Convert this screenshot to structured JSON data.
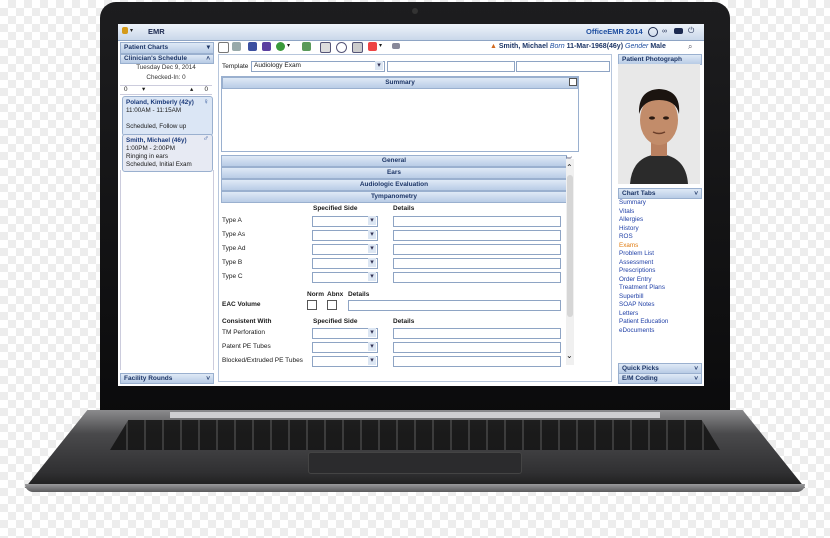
{
  "app": {
    "title": "EMR",
    "product": "OfficeEMR 2014"
  },
  "patient": {
    "name": "Smith, Michael",
    "born_label": "Born",
    "born": "11-Mar-1968(46y)",
    "gender_label": "Gender",
    "gender": "Male"
  },
  "left": {
    "patient_charts": "Patient Charts",
    "schedule_title": "Clinician's Schedule",
    "date": "Tuesday Dec 9, 2014",
    "checked_in": "Checked-In: 0",
    "counter_left": "0",
    "counter_right": "0",
    "appointments": [
      {
        "name": "Poland, Kimberly (42y)",
        "time": "11:00AM - 11:15AM",
        "reason": "",
        "status": "Scheduled, Follow up"
      },
      {
        "name": "Smith, Michael (46y)",
        "time": "1:00PM - 2:00PM",
        "reason": "Ringing in ears",
        "status": "Scheduled, Initial Exam"
      }
    ],
    "facility_rounds": "Facility Rounds"
  },
  "center": {
    "template_label": "Template",
    "template_value": "Audiology Exam",
    "summary": "Summary",
    "sections": [
      "General",
      "Ears",
      "Audiologic Evaluation",
      "Tympanometry"
    ],
    "specified_side": "Specified Side",
    "details": "Details",
    "types": [
      "Type A",
      "Type As",
      "Type Ad",
      "Type B",
      "Type C"
    ],
    "norm": "Norm",
    "abnx": "Abnx",
    "eac_volume": "EAC Volume",
    "consistent_with": "Consistent With",
    "consistent_rows": [
      "TM Perforation",
      "Patent PE Tubes",
      "Blocked/Extruded PE Tubes"
    ]
  },
  "right": {
    "photo_title": "Patient Photograph",
    "chart_tabs": "Chart Tabs",
    "tabs": [
      "Summary",
      "Vitals",
      "Allergies",
      "History",
      "ROS",
      "Exams",
      "Problem List",
      "Assessment",
      "Prescriptions",
      "Order Entry",
      "Treatment Plans",
      "Superbill",
      "SOAP Notes",
      "Letters",
      "Patient Education",
      "eDocuments"
    ],
    "active_tab": "Exams",
    "quick_picks": "Quick Picks",
    "em_coding": "E/M Coding"
  },
  "colors": {
    "accent": "#1f4fa0",
    "active_tab": "#e07c12"
  }
}
